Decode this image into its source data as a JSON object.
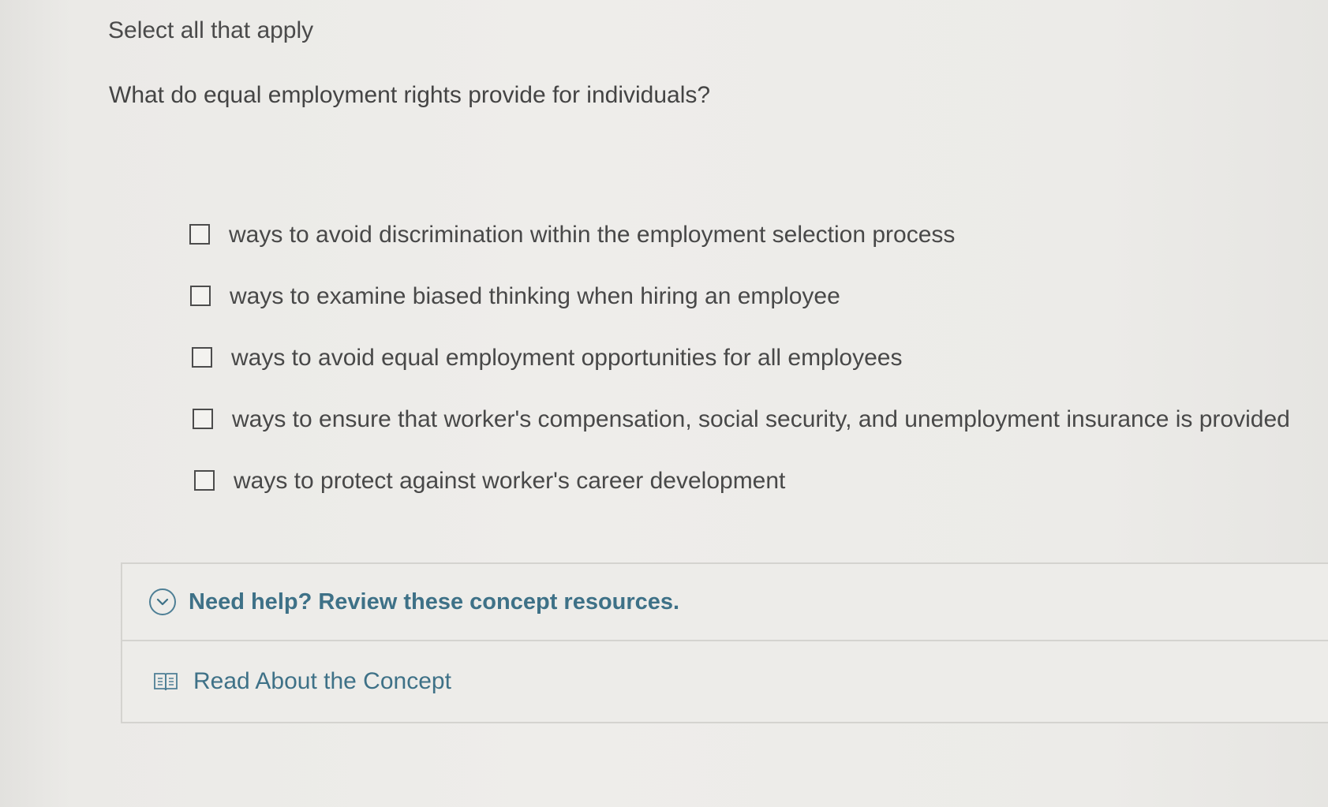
{
  "instruction": "Select all that apply",
  "question": "What do equal employment rights provide for individuals?",
  "options": [
    {
      "label": "ways to avoid discrimination within the employment selection process",
      "checked": false
    },
    {
      "label": "ways to examine biased thinking when hiring an employee",
      "checked": false
    },
    {
      "label": "ways to avoid equal employment opportunities for all employees",
      "checked": false
    },
    {
      "label": "ways to ensure that worker's compensation, social security, and unemployment insurance is provided",
      "checked": false
    },
    {
      "label": "ways to protect against worker's career development",
      "checked": false
    }
  ],
  "help": {
    "title": "Need help? Review these concept resources.",
    "icon": "chevron-down-circle-icon",
    "resources": [
      {
        "label": "Read About the Concept",
        "icon": "book-icon"
      }
    ]
  },
  "colors": {
    "accent": "#3e7187",
    "text": "#444444",
    "background": "#eceae7"
  }
}
